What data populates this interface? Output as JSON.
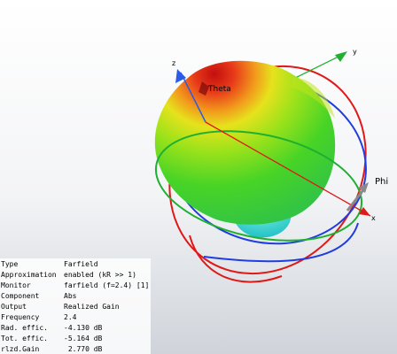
{
  "viewport": {
    "axis_labels": {
      "x": "x",
      "y": "y",
      "z": "z"
    },
    "theta_label": "Theta",
    "phi_label": "Phi",
    "colors": {
      "gain_max": "#e21b1b",
      "gain_mid": "#9be21b",
      "gain_low": "#36cfcf",
      "ring_red": "#e01818",
      "ring_blue": "#1f3de0",
      "ring_green": "#1fb030",
      "axis_red": "#e01818",
      "axis_green": "#1fb030",
      "axis_blue": "#2a5ce8",
      "phi_arrow": "#8a8a8a"
    }
  },
  "info": {
    "rows": [
      {
        "key": "Type",
        "value": "Farfield"
      },
      {
        "key": "Approximation",
        "value": "enabled (kR >> 1)"
      },
      {
        "key": "Monitor",
        "value": "farfield (f=2.4) [1]"
      },
      {
        "key": "Component",
        "value": "Abs"
      },
      {
        "key": "Output",
        "value": "Realized Gain"
      },
      {
        "key": "Frequency",
        "value": "2.4"
      },
      {
        "key": "Rad. effic.",
        "value": "-4.130 dB"
      },
      {
        "key": "Tot. effic.",
        "value": "-5.164 dB"
      },
      {
        "key": "rlzd.Gain",
        "value": " 2.770 dB"
      }
    ]
  }
}
